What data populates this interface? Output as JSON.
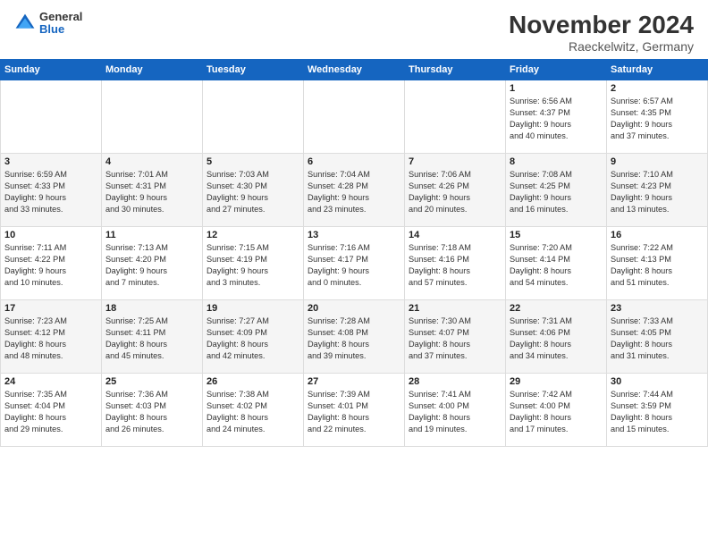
{
  "logo": {
    "general": "General",
    "blue": "Blue"
  },
  "title": "November 2024",
  "subtitle": "Raeckelwitz, Germany",
  "days_header": [
    "Sunday",
    "Monday",
    "Tuesday",
    "Wednesday",
    "Thursday",
    "Friday",
    "Saturday"
  ],
  "weeks": [
    [
      {
        "day": "",
        "info": ""
      },
      {
        "day": "",
        "info": ""
      },
      {
        "day": "",
        "info": ""
      },
      {
        "day": "",
        "info": ""
      },
      {
        "day": "",
        "info": ""
      },
      {
        "day": "1",
        "info": "Sunrise: 6:56 AM\nSunset: 4:37 PM\nDaylight: 9 hours\nand 40 minutes."
      },
      {
        "day": "2",
        "info": "Sunrise: 6:57 AM\nSunset: 4:35 PM\nDaylight: 9 hours\nand 37 minutes."
      }
    ],
    [
      {
        "day": "3",
        "info": "Sunrise: 6:59 AM\nSunset: 4:33 PM\nDaylight: 9 hours\nand 33 minutes."
      },
      {
        "day": "4",
        "info": "Sunrise: 7:01 AM\nSunset: 4:31 PM\nDaylight: 9 hours\nand 30 minutes."
      },
      {
        "day": "5",
        "info": "Sunrise: 7:03 AM\nSunset: 4:30 PM\nDaylight: 9 hours\nand 27 minutes."
      },
      {
        "day": "6",
        "info": "Sunrise: 7:04 AM\nSunset: 4:28 PM\nDaylight: 9 hours\nand 23 minutes."
      },
      {
        "day": "7",
        "info": "Sunrise: 7:06 AM\nSunset: 4:26 PM\nDaylight: 9 hours\nand 20 minutes."
      },
      {
        "day": "8",
        "info": "Sunrise: 7:08 AM\nSunset: 4:25 PM\nDaylight: 9 hours\nand 16 minutes."
      },
      {
        "day": "9",
        "info": "Sunrise: 7:10 AM\nSunset: 4:23 PM\nDaylight: 9 hours\nand 13 minutes."
      }
    ],
    [
      {
        "day": "10",
        "info": "Sunrise: 7:11 AM\nSunset: 4:22 PM\nDaylight: 9 hours\nand 10 minutes."
      },
      {
        "day": "11",
        "info": "Sunrise: 7:13 AM\nSunset: 4:20 PM\nDaylight: 9 hours\nand 7 minutes."
      },
      {
        "day": "12",
        "info": "Sunrise: 7:15 AM\nSunset: 4:19 PM\nDaylight: 9 hours\nand 3 minutes."
      },
      {
        "day": "13",
        "info": "Sunrise: 7:16 AM\nSunset: 4:17 PM\nDaylight: 9 hours\nand 0 minutes."
      },
      {
        "day": "14",
        "info": "Sunrise: 7:18 AM\nSunset: 4:16 PM\nDaylight: 8 hours\nand 57 minutes."
      },
      {
        "day": "15",
        "info": "Sunrise: 7:20 AM\nSunset: 4:14 PM\nDaylight: 8 hours\nand 54 minutes."
      },
      {
        "day": "16",
        "info": "Sunrise: 7:22 AM\nSunset: 4:13 PM\nDaylight: 8 hours\nand 51 minutes."
      }
    ],
    [
      {
        "day": "17",
        "info": "Sunrise: 7:23 AM\nSunset: 4:12 PM\nDaylight: 8 hours\nand 48 minutes."
      },
      {
        "day": "18",
        "info": "Sunrise: 7:25 AM\nSunset: 4:11 PM\nDaylight: 8 hours\nand 45 minutes."
      },
      {
        "day": "19",
        "info": "Sunrise: 7:27 AM\nSunset: 4:09 PM\nDaylight: 8 hours\nand 42 minutes."
      },
      {
        "day": "20",
        "info": "Sunrise: 7:28 AM\nSunset: 4:08 PM\nDaylight: 8 hours\nand 39 minutes."
      },
      {
        "day": "21",
        "info": "Sunrise: 7:30 AM\nSunset: 4:07 PM\nDaylight: 8 hours\nand 37 minutes."
      },
      {
        "day": "22",
        "info": "Sunrise: 7:31 AM\nSunset: 4:06 PM\nDaylight: 8 hours\nand 34 minutes."
      },
      {
        "day": "23",
        "info": "Sunrise: 7:33 AM\nSunset: 4:05 PM\nDaylight: 8 hours\nand 31 minutes."
      }
    ],
    [
      {
        "day": "24",
        "info": "Sunrise: 7:35 AM\nSunset: 4:04 PM\nDaylight: 8 hours\nand 29 minutes."
      },
      {
        "day": "25",
        "info": "Sunrise: 7:36 AM\nSunset: 4:03 PM\nDaylight: 8 hours\nand 26 minutes."
      },
      {
        "day": "26",
        "info": "Sunrise: 7:38 AM\nSunset: 4:02 PM\nDaylight: 8 hours\nand 24 minutes."
      },
      {
        "day": "27",
        "info": "Sunrise: 7:39 AM\nSunset: 4:01 PM\nDaylight: 8 hours\nand 22 minutes."
      },
      {
        "day": "28",
        "info": "Sunrise: 7:41 AM\nSunset: 4:00 PM\nDaylight: 8 hours\nand 19 minutes."
      },
      {
        "day": "29",
        "info": "Sunrise: 7:42 AM\nSunset: 4:00 PM\nDaylight: 8 hours\nand 17 minutes."
      },
      {
        "day": "30",
        "info": "Sunrise: 7:44 AM\nSunset: 3:59 PM\nDaylight: 8 hours\nand 15 minutes."
      }
    ]
  ]
}
